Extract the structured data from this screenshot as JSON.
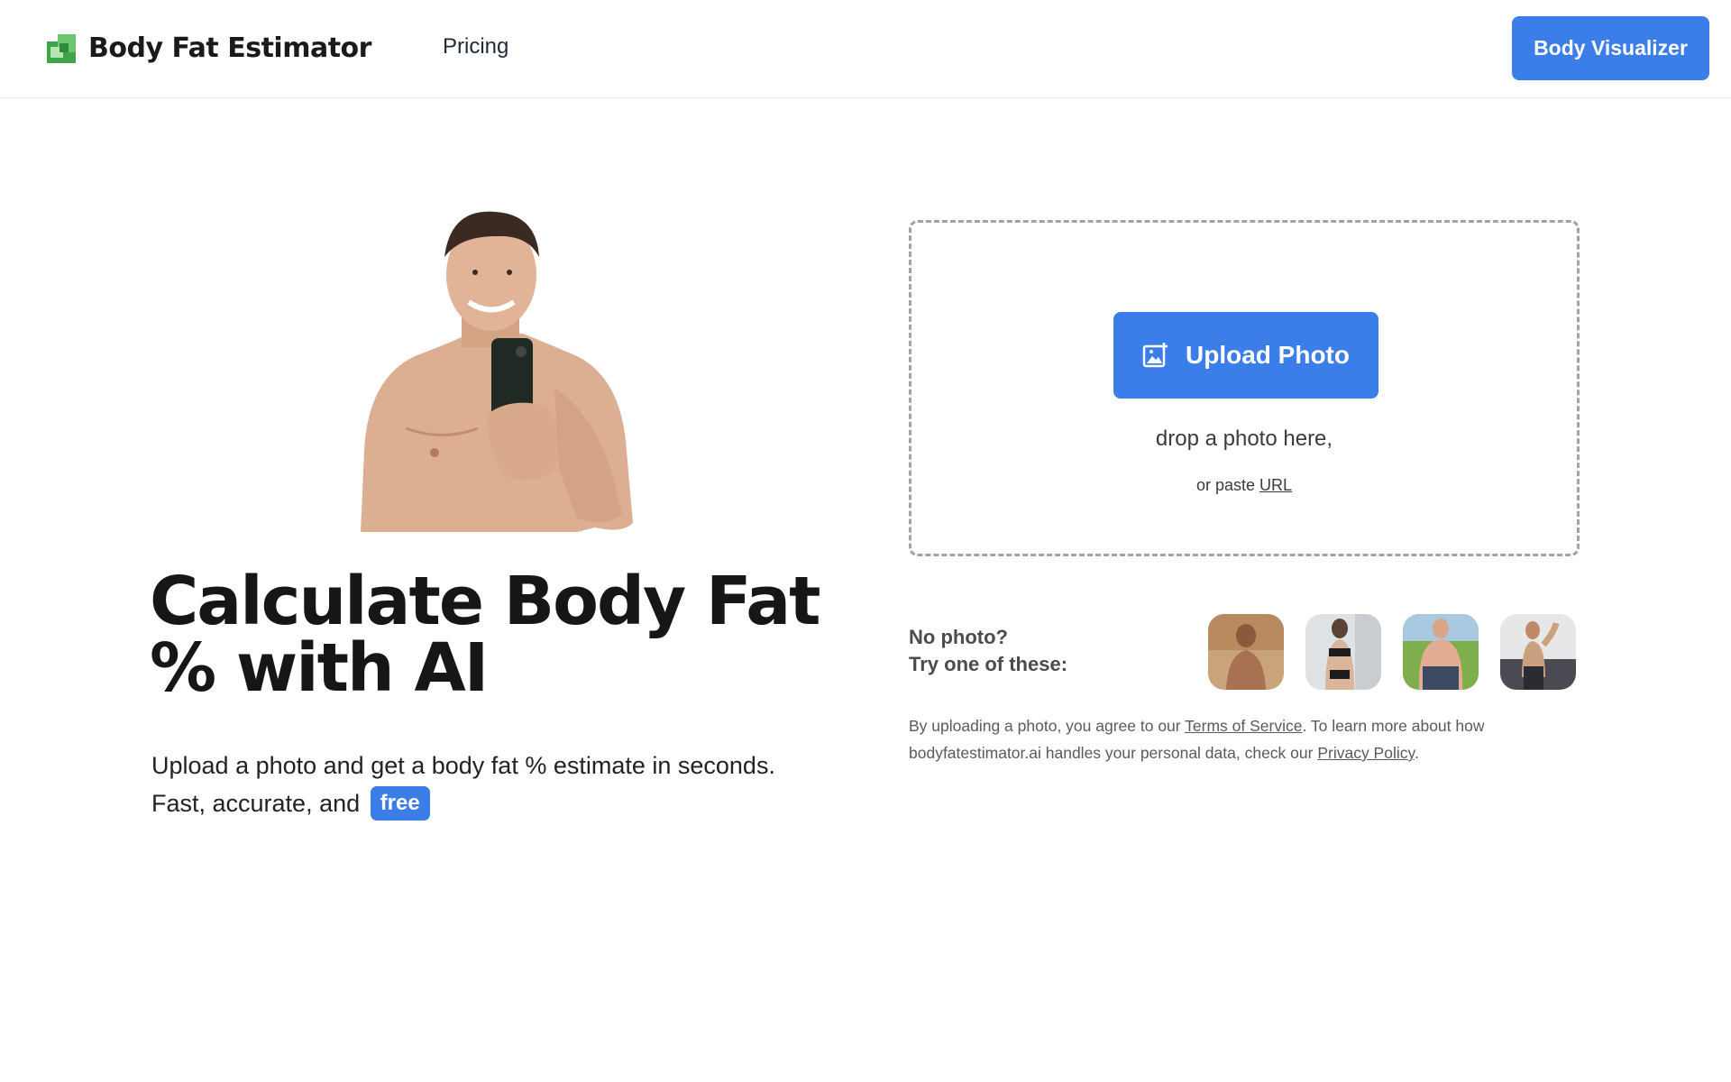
{
  "header": {
    "brand": "Body Fat Estimator",
    "nav_pricing": "Pricing",
    "cta_label": "Body Visualizer"
  },
  "hero": {
    "title": "Calculate Body Fat % with AI",
    "subtitle_line1": "Upload a photo and get a body fat % estimate in seconds.",
    "subtitle_line2": "Fast, accurate, and",
    "free_badge": "free"
  },
  "upload": {
    "button_label": "Upload Photo",
    "drop_text": "drop a photo here,",
    "paste_prefix": "or paste",
    "paste_link": "URL"
  },
  "samples": {
    "line1": "No photo?",
    "line2": "Try one of these:"
  },
  "legal": {
    "part1": "By uploading a photo, you agree to our ",
    "terms_link": "Terms of Service",
    "part2": ". To learn more about how bodyfatestimator.ai handles your personal data, check our ",
    "privacy_link": "Privacy Policy",
    "part3": "."
  },
  "colors": {
    "accent": "#3b7ee9",
    "logo_green": "#4caf50"
  }
}
